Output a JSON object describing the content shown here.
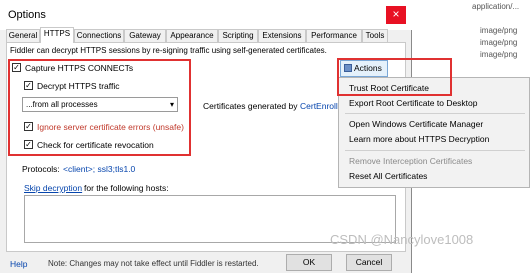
{
  "background_list": {
    "rows": [
      {
        "text": "application/...",
        "y": 0
      },
      {
        "text": "image/png",
        "y": 1
      },
      {
        "text": "image/png",
        "y": 2
      },
      {
        "text": "image/png",
        "y": 3
      }
    ]
  },
  "window": {
    "title": "Options",
    "close_glyph": "×"
  },
  "tabs": [
    {
      "label": "General"
    },
    {
      "label": "HTTPS"
    },
    {
      "label": "Connections"
    },
    {
      "label": "Gateway"
    },
    {
      "label": "Appearance"
    },
    {
      "label": "Scripting"
    },
    {
      "label": "Extensions"
    },
    {
      "label": "Performance"
    },
    {
      "label": "Tools"
    }
  ],
  "https": {
    "description": "Fiddler can decrypt HTTPS sessions by re-signing traffic using self-generated certificates.",
    "capture_label": "Capture HTTPS CONNECTs",
    "decrypt_label": "Decrypt HTTPS traffic",
    "process_select_value": "...from all processes",
    "ignore_errors_label": "Ignore server certificate errors (unsafe)",
    "revocation_label": "Check for certificate revocation",
    "certs_generated_by": "Certificates generated by",
    "cert_engine_link": "CertEnroll e",
    "protocols_label": "Protocols:",
    "protocols_value": "<client>; ssl3;tls1.0",
    "skip_decryption_link": "Skip decryption",
    "skip_decryption_suffix": "for the following hosts:",
    "hosts_value": ""
  },
  "footer": {
    "help_link": "Help",
    "note": "Note: Changes may not take effect until Fiddler is restarted.",
    "ok_label": "OK",
    "cancel_label": "Cancel"
  },
  "actions": {
    "button_label": "Actions",
    "menu": [
      {
        "label": "Trust Root Certificate",
        "disabled": false
      },
      {
        "label": "Export Root Certificate to Desktop",
        "disabled": false
      },
      {
        "label": "Open Windows Certificate Manager",
        "disabled": false
      },
      {
        "label": "Learn more about HTTPS Decryption",
        "disabled": false
      },
      {
        "label": "Remove Interception Certificates",
        "disabled": true
      },
      {
        "label": "Reset All Certificates",
        "disabled": false
      }
    ]
  },
  "watermark": "CSDN @Nancylove1008",
  "colors": {
    "highlight": "#e03131",
    "link": "#0645ad",
    "error_text": "#c0392b"
  }
}
